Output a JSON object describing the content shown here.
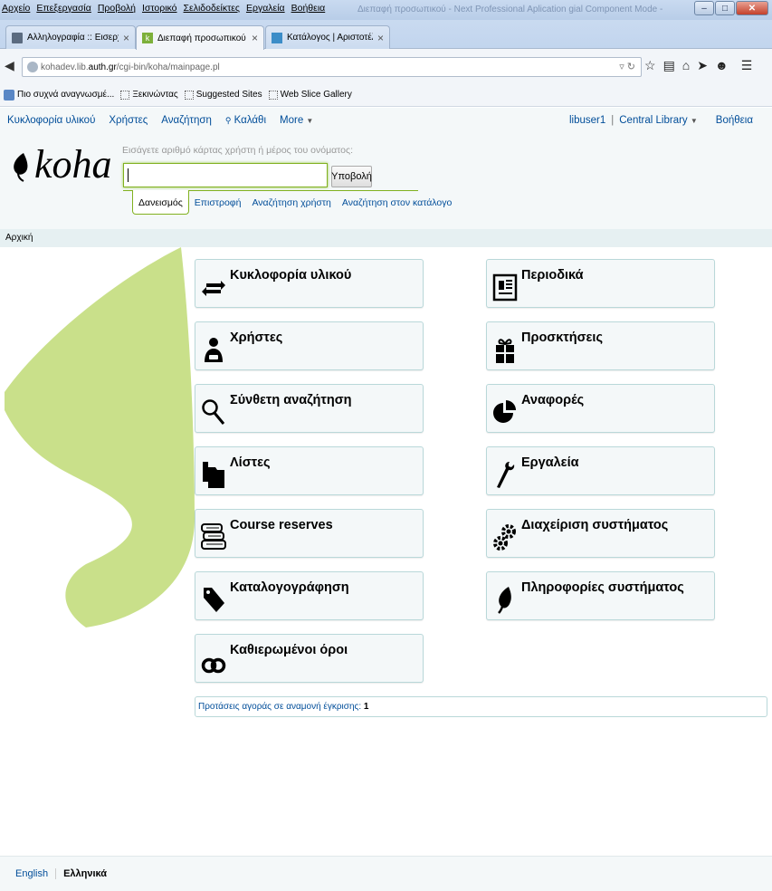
{
  "browser": {
    "menu": [
      "Αρχείο",
      "Επεξεργασία",
      "Προβολή",
      "Ιστορικό",
      "Σελιδοδείκτες",
      "Εργαλεία",
      "Βοήθεια"
    ],
    "window_title": "Διεπαφή προσωπικού - Next Professional Aplication gial Component Mode - Mozilla Firefox",
    "tabs": [
      {
        "label": "Αλληλογραφία :: Εισερχόμ..."
      },
      {
        "label": "Διεπαφή προσωπικού"
      },
      {
        "label": "Κατάλογος | Αριστοτέλειο ..."
      }
    ],
    "url_prefix": "kohadev.lib.",
    "url_domain": "auth.gr",
    "url_path": "/cgi-bin/koha/mainpage.pl",
    "bookmarks": [
      "Πιο συχνά αναγνωσμέ...",
      "Ξεκινώντας",
      "Suggested Sites",
      "Web Slice Gallery"
    ]
  },
  "koha": {
    "nav": {
      "circulation": "Κυκλοφορία υλικού",
      "patrons": "Χρήστες",
      "search": "Αναζήτηση",
      "cart": "Καλάθι",
      "more": "More"
    },
    "user": {
      "name": "libuser1",
      "library": "Central Library",
      "help": "Βοήθεια"
    },
    "logo_text": "koha",
    "search": {
      "hint": "Εισάγετε αριθμό κάρτας χρήστη ή μέρος του ονόματος:",
      "value": "",
      "submit": "Υποβολή"
    },
    "subtabs": [
      "Δανεισμός",
      "Επιστροφή",
      "Αναζήτηση χρήστη",
      "Αναζήτηση στον κατάλογο"
    ],
    "breadcrumb": "Αρχική",
    "modules_left": [
      {
        "label": "Κυκλοφορία υλικού",
        "icon": "circulation-arrows-icon"
      },
      {
        "label": "Χρήστες",
        "icon": "patron-person-icon"
      },
      {
        "label": "Σύνθετη αναζήτηση",
        "icon": "magnifier-icon"
      },
      {
        "label": "Λίστες",
        "icon": "folder-icon"
      },
      {
        "label": "Course reserves",
        "icon": "books-stack-icon"
      },
      {
        "label": "Καταλογογράφηση",
        "icon": "tag-icon"
      },
      {
        "label": "Καθιερωμένοι όροι",
        "icon": "chain-link-icon"
      }
    ],
    "modules_right": [
      {
        "label": "Περιοδικά",
        "icon": "newspaper-icon"
      },
      {
        "label": "Προσκτήσεις",
        "icon": "gift-icon"
      },
      {
        "label": "Αναφορές",
        "icon": "pie-chart-icon"
      },
      {
        "label": "Εργαλεία",
        "icon": "wrench-icon"
      },
      {
        "label": "Διαχείριση συστήματος",
        "icon": "gears-icon"
      },
      {
        "label": "Πληροφορίες συστήματος",
        "icon": "koha-leaf-icon"
      }
    ],
    "pending_label": "Προτάσεις αγοράς σε αναμονή έγκρισης:",
    "pending_count": "1",
    "footer_langs": [
      "English",
      "Ελληνικά"
    ]
  },
  "colors": {
    "brand_green": "#c9e08a",
    "link_blue": "#004d99",
    "tile_border": "#b9d8d9"
  }
}
